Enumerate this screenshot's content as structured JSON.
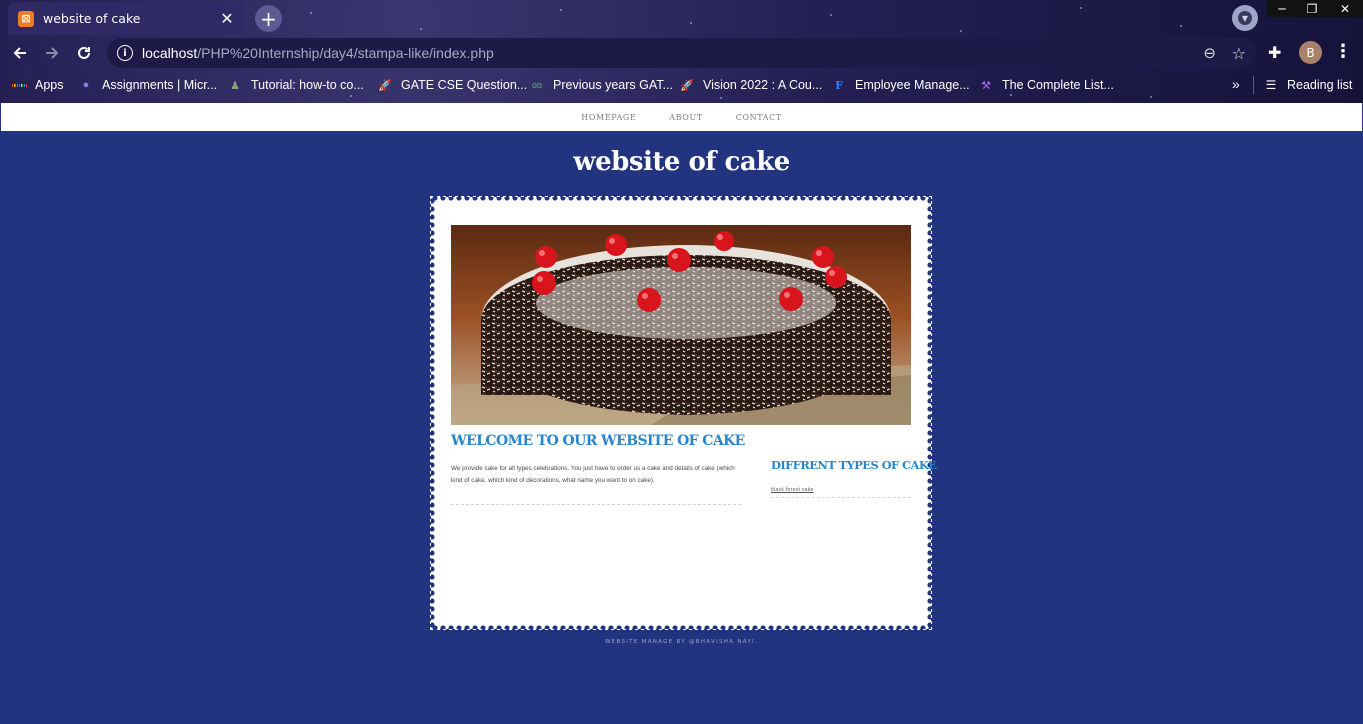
{
  "browser": {
    "tab": {
      "title": "website of cake",
      "favicon": "xampp-icon",
      "close": "✕"
    },
    "new_tab": "+",
    "window_controls": {
      "minimize": "─",
      "restore": "❐",
      "close": "✕"
    },
    "url": {
      "host": "localhost",
      "path": "/PHP%20Internship/day4/stampa-like/index.php"
    },
    "profile_initial": "B",
    "bookmarks": [
      {
        "label": "Apps",
        "icon": "apps-grid-icon"
      },
      {
        "label": "Assignments | Micr...",
        "icon": "teams-icon"
      },
      {
        "label": "Tutorial: how-to co...",
        "icon": "bookmark-figure-icon"
      },
      {
        "label": "GATE CSE Question...",
        "icon": "rocket-icon"
      },
      {
        "label": "Previous years GAT...",
        "icon": "gg-icon"
      },
      {
        "label": "Vision 2022 : A Cou...",
        "icon": "rocket-icon"
      },
      {
        "label": "Employee Manage...",
        "icon": "f-logo-icon"
      },
      {
        "label": "The Complete List...",
        "icon": "hammer-icon"
      }
    ],
    "bookmarks_overflow": "»",
    "reading_list": "Reading list"
  },
  "site": {
    "nav": [
      "HOMEPAGE",
      "ABOUT",
      "CONTACT"
    ],
    "title": "website of cake",
    "welcome_heading": "WELCOME TO OUR WEBSITE OF CAKE",
    "welcome_text": "We provide cake for all types celebrations. You just have to order us a cake and details of cake (which kind of cake, which kind of decorations, what name you want to on cake).",
    "side_heading": "DIFFRENT TYPES OF CAKE",
    "side_items": [
      "black forest cake"
    ],
    "footer": "WEBSITE MANAGE BY @BHAVISHA NAYI."
  },
  "colors": {
    "page_bg": "#22337f",
    "heading_blue": "#2a86c8",
    "chrome_bg": "#231f52"
  }
}
